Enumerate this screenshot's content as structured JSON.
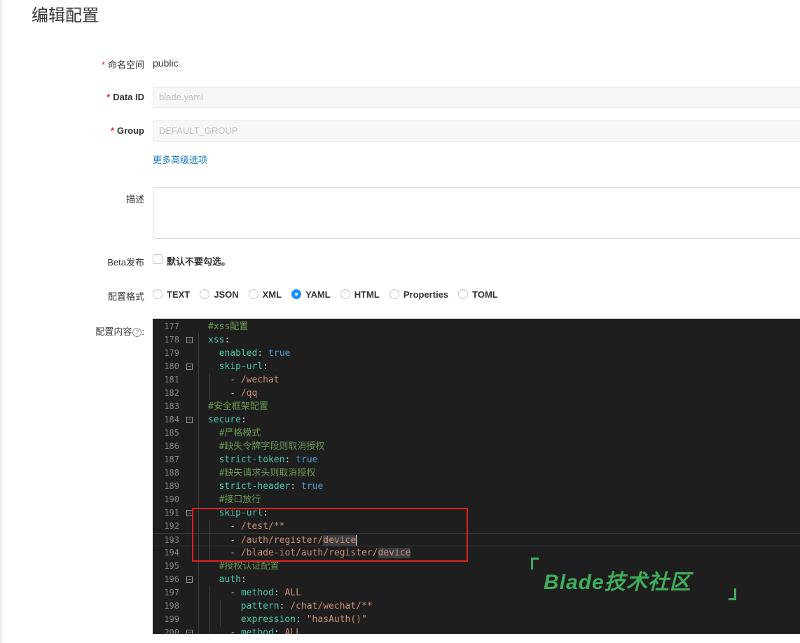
{
  "page": {
    "title": "编辑配置"
  },
  "form": {
    "namespace": {
      "label": "命名空间",
      "value": "public"
    },
    "data_id": {
      "label": "Data ID",
      "value": "blade.yaml"
    },
    "group": {
      "label": "Group",
      "value": "DEFAULT_GROUP"
    },
    "more_options_link": "更多高级选项",
    "description": {
      "label": "描述",
      "value": ""
    },
    "beta": {
      "label": "Beta发布",
      "checkbox_label": "默认不要勾选。"
    },
    "format": {
      "label": "配置格式",
      "options": [
        "TEXT",
        "JSON",
        "XML",
        "YAML",
        "HTML",
        "Properties",
        "TOML"
      ],
      "selected": "YAML"
    },
    "content": {
      "label": "配置内容",
      "help_icon": "?",
      "colon": ":"
    }
  },
  "editor": {
    "lines": [
      {
        "n": "177",
        "comment": "#xss配置"
      },
      {
        "n": "178",
        "key": "xss"
      },
      {
        "n": "179",
        "key": "enabled",
        "value": "true"
      },
      {
        "n": "180",
        "key": "skip-url"
      },
      {
        "n": "181",
        "item": "/wechat"
      },
      {
        "n": "182",
        "item": "/qq"
      },
      {
        "n": "183",
        "comment": "#安全框架配置"
      },
      {
        "n": "184",
        "key": "secure"
      },
      {
        "n": "185",
        "comment": "#严格模式"
      },
      {
        "n": "186",
        "comment": "#缺失令牌字段则取消授权"
      },
      {
        "n": "187",
        "key": "strict-token",
        "value": "true"
      },
      {
        "n": "188",
        "comment": "#缺失请求头则取消授权"
      },
      {
        "n": "189",
        "key": "strict-header",
        "value": "true"
      },
      {
        "n": "190",
        "comment": "#接口放行"
      },
      {
        "n": "191",
        "key": "skip-url"
      },
      {
        "n": "192",
        "item": "/test/**"
      },
      {
        "n": "193",
        "item_a": "/auth/register/",
        "item_b": "device"
      },
      {
        "n": "194",
        "item_a": "/blade-iot/auth/register/",
        "item_b": "device"
      },
      {
        "n": "195",
        "comment": "#授权认证配置"
      },
      {
        "n": "196",
        "key": "auth"
      },
      {
        "n": "197",
        "key": "method",
        "value": "ALL"
      },
      {
        "n": "198",
        "key": "pattern",
        "value": "/chat/wechat/**"
      },
      {
        "n": "199",
        "key": "expression",
        "value": "\"hasAuth()\""
      },
      {
        "n": "200",
        "key": "method",
        "value": "ALL"
      }
    ]
  },
  "watermark": {
    "text": "Blade技术社区"
  },
  "colors": {
    "accent": "#1890ff",
    "link": "#1677b8",
    "required": "#f5222d",
    "highlight_box": "#e02020",
    "watermark": "#3fae5b"
  }
}
